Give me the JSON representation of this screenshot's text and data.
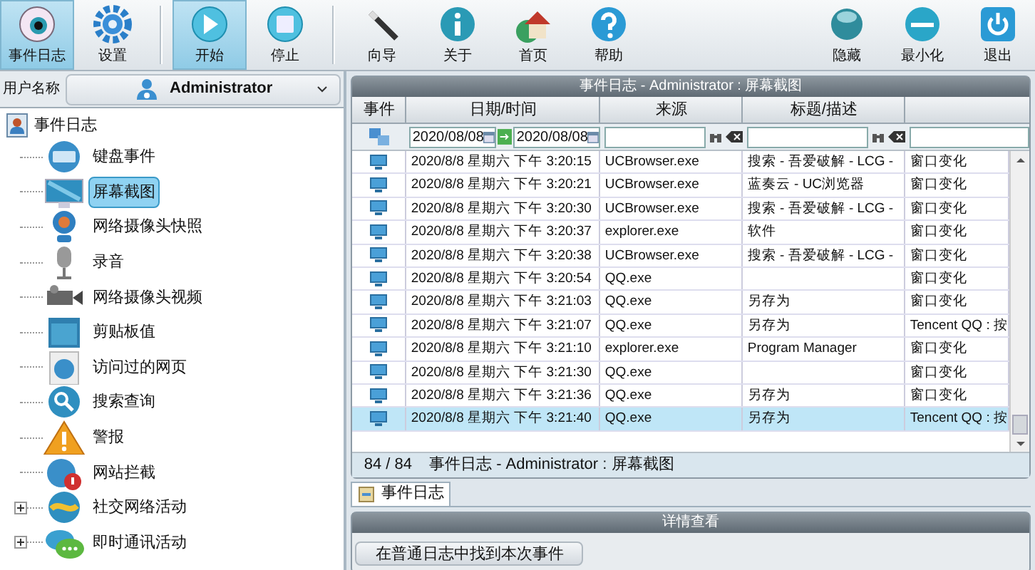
{
  "toolbar": {
    "groups": [
      {
        "buttons": [
          {
            "label": "事件日志",
            "selected": true
          },
          {
            "label": "设置",
            "selected": false
          }
        ]
      },
      {
        "buttons": [
          {
            "label": "开始",
            "selected": true
          },
          {
            "label": "停止",
            "selected": false
          }
        ]
      },
      {
        "buttons": [
          {
            "label": "向导",
            "selected": false
          },
          {
            "label": "关于",
            "selected": false
          },
          {
            "label": "首页",
            "selected": false
          },
          {
            "label": "帮助",
            "selected": false
          }
        ]
      },
      {
        "buttons": [
          {
            "label": "隐藏",
            "selected": false
          },
          {
            "label": "最小化",
            "selected": false
          },
          {
            "label": "退出",
            "selected": false
          }
        ]
      }
    ]
  },
  "user": {
    "label": "用户名称",
    "value": "Administrator"
  },
  "tree": {
    "label": "事件日志",
    "children": [
      {
        "label": "键盘事件",
        "kind": "leaf",
        "selected": false
      },
      {
        "label": "屏幕截图",
        "kind": "leaf",
        "selected": true
      },
      {
        "label": "网络摄像头快照",
        "kind": "leaf",
        "selected": false
      },
      {
        "label": "录音",
        "kind": "leaf",
        "selected": false
      },
      {
        "label": "网络摄像头视频",
        "kind": "leaf",
        "selected": false
      },
      {
        "label": "剪贴板值",
        "kind": "leaf",
        "selected": false
      },
      {
        "label": "访问过的网页",
        "kind": "leaf",
        "selected": false
      },
      {
        "label": "搜索查询",
        "kind": "leaf",
        "selected": false
      },
      {
        "label": "警报",
        "kind": "leaf",
        "selected": false
      },
      {
        "label": "网站拦截",
        "kind": "leaf",
        "selected": false
      },
      {
        "label": "社交网络活动",
        "kind": "group",
        "expanded": false,
        "selected": false
      },
      {
        "label": "即时通讯活动",
        "kind": "group",
        "expanded": false,
        "selected": false
      }
    ]
  },
  "log_panel": {
    "title": "事件日志 - Administrator : 屏幕截图",
    "columns": [
      "事件",
      "日期/时间",
      "来源",
      "标题/描述"
    ],
    "filter": {
      "date_from": "2020/08/08",
      "date_to": "2020/08/08"
    },
    "rows": [
      {
        "date_time": "2020/8/8 星期六 下午 3:20:15",
        "source": "UCBrowser.exe",
        "title": "搜索 - 吾爱破解 - LCG -",
        "column_5": "窗口变化",
        "selected": false
      },
      {
        "date_time": "2020/8/8 星期六 下午 3:20:21",
        "source": "UCBrowser.exe",
        "title": "蓝奏云 - UC浏览器",
        "column_5": "窗口变化",
        "selected": false
      },
      {
        "date_time": "2020/8/8 星期六 下午 3:20:30",
        "source": "UCBrowser.exe",
        "title": "搜索 - 吾爱破解 - LCG -",
        "column_5": "窗口变化",
        "selected": false
      },
      {
        "date_time": "2020/8/8 星期六 下午 3:20:37",
        "source": "explorer.exe",
        "title": "软件",
        "column_5": "窗口变化",
        "selected": false
      },
      {
        "date_time": "2020/8/8 星期六 下午 3:20:38",
        "source": "UCBrowser.exe",
        "title": "搜索 - 吾爱破解 - LCG -",
        "column_5": "窗口变化",
        "selected": false
      },
      {
        "date_time": "2020/8/8 星期六 下午 3:20:54",
        "source": "QQ.exe",
        "column_5": "窗口变化",
        "selected": false
      },
      {
        "date_time": "2020/8/8 星期六 下午 3:21:03",
        "source": "QQ.exe",
        "title": "另存为",
        "column_5": "窗口变化",
        "selected": false
      },
      {
        "date_time": "2020/8/8 星期六 下午 3:21:07",
        "source": "QQ.exe",
        "title": "另存为",
        "column_5": "Tencent QQ : 按",
        "selected": false
      },
      {
        "date_time": "2020/8/8 星期六 下午 3:21:10",
        "source": "explorer.exe",
        "title": "Program Manager",
        "column_5": "窗口变化",
        "selected": false
      },
      {
        "date_time": "2020/8/8 星期六 下午 3:21:30",
        "source": "QQ.exe",
        "column_5": "窗口变化",
        "selected": false
      },
      {
        "date_time": "2020/8/8 星期六 下午 3:21:36",
        "source": "QQ.exe",
        "title": "另存为",
        "column_5": "窗口变化",
        "selected": false
      },
      {
        "date_time": "2020/8/8 星期六 下午 3:21:40",
        "source": "QQ.exe",
        "title": "另存为",
        "column_5": "Tencent QQ : 按",
        "selected": true
      }
    ],
    "status": {
      "count": "84 / 84",
      "text": "事件日志 - Administrator : 屏幕截图"
    }
  },
  "tabs": [
    {
      "label": "事件日志",
      "selected": true
    }
  ],
  "details": {
    "title": "详情查看",
    "button": "在普通日志中找到本次事件"
  }
}
